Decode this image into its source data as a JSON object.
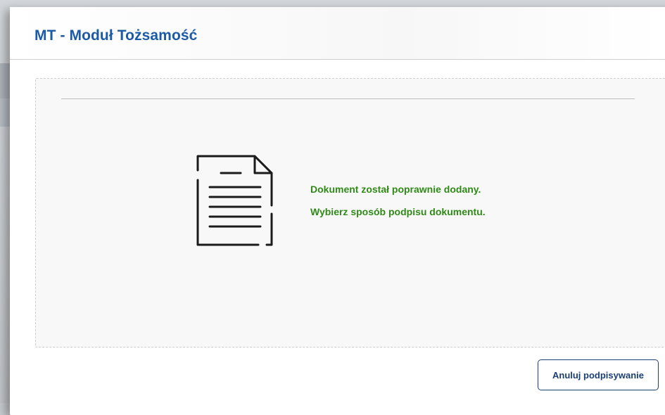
{
  "modal": {
    "title": "MT - Moduł Tożsamość"
  },
  "content": {
    "icon": "document-icon",
    "messages": [
      "Dokument został poprawnie dodany.",
      "Wybierz sposób podpisu dokumentu."
    ]
  },
  "footer": {
    "cancel_label": "Anuluj podpisywanie"
  },
  "colors": {
    "title": "#1b5aa6",
    "success_text": "#2f8a17",
    "button_border": "#1b3f73"
  }
}
